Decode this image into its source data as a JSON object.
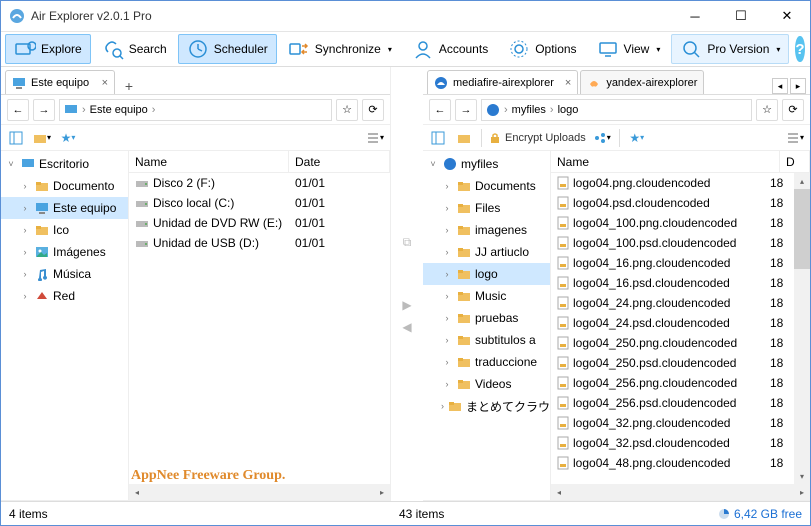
{
  "titlebar": {
    "title": "Air Explorer v2.0.1 Pro"
  },
  "toolbar": {
    "explore": "Explore",
    "search": "Search",
    "scheduler": "Scheduler",
    "synchronize": "Synchronize",
    "accounts": "Accounts",
    "options": "Options",
    "view": "View",
    "pro": "Pro Version"
  },
  "left": {
    "tabs": [
      {
        "label": "Este equipo"
      }
    ],
    "breadcrumb": [
      "Este equipo"
    ],
    "columns": {
      "name": "Name",
      "date": "Date"
    },
    "tree_root": "Escritorio",
    "tree": [
      {
        "label": "Documento",
        "icon": "folder"
      },
      {
        "label": "Este equipo",
        "icon": "pc",
        "selected": true
      },
      {
        "label": "Ico",
        "icon": "folder"
      },
      {
        "label": "Imágenes",
        "icon": "picture"
      },
      {
        "label": "Música",
        "icon": "music"
      },
      {
        "label": "Red",
        "icon": "net"
      }
    ],
    "rows": [
      {
        "name": "Disco 2 (F:)",
        "date": "01/01"
      },
      {
        "name": "Disco local (C:)",
        "date": "01/01"
      },
      {
        "name": "Unidad de DVD RW (E:)",
        "date": "01/01"
      },
      {
        "name": "Unidad de USB (D:)",
        "date": "01/01"
      }
    ],
    "status": "4 items"
  },
  "right": {
    "tabs": [
      {
        "label": "mediafire-airexplorer",
        "active": true
      },
      {
        "label": "yandex-airexplorer",
        "active": false
      }
    ],
    "breadcrumb": [
      "myfiles",
      "logo"
    ],
    "encrypt_label": "Encrypt Uploads",
    "columns": {
      "name": "Name",
      "d": "D"
    },
    "tree_root": "myfiles",
    "tree": [
      {
        "label": "Documents"
      },
      {
        "label": "Files"
      },
      {
        "label": "imagenes"
      },
      {
        "label": "JJ artiuclo"
      },
      {
        "label": "logo",
        "selected": true
      },
      {
        "label": "Music"
      },
      {
        "label": "pruebas"
      },
      {
        "label": "subtitulos a"
      },
      {
        "label": "traduccione"
      },
      {
        "label": "Videos"
      },
      {
        "label": "まとめてクラウ"
      }
    ],
    "rows": [
      {
        "name": "logo04.png.cloudencoded",
        "d": "18"
      },
      {
        "name": "logo04.psd.cloudencoded",
        "d": "18"
      },
      {
        "name": "logo04_100.png.cloudencoded",
        "d": "18"
      },
      {
        "name": "logo04_100.psd.cloudencoded",
        "d": "18"
      },
      {
        "name": "logo04_16.png.cloudencoded",
        "d": "18"
      },
      {
        "name": "logo04_16.psd.cloudencoded",
        "d": "18"
      },
      {
        "name": "logo04_24.png.cloudencoded",
        "d": "18"
      },
      {
        "name": "logo04_24.psd.cloudencoded",
        "d": "18"
      },
      {
        "name": "logo04_250.png.cloudencoded",
        "d": "18"
      },
      {
        "name": "logo04_250.psd.cloudencoded",
        "d": "18"
      },
      {
        "name": "logo04_256.png.cloudencoded",
        "d": "18"
      },
      {
        "name": "logo04_256.psd.cloudencoded",
        "d": "18"
      },
      {
        "name": "logo04_32.png.cloudencoded",
        "d": "18"
      },
      {
        "name": "logo04_32.psd.cloudencoded",
        "d": "18"
      },
      {
        "name": "logo04_48.png.cloudencoded",
        "d": "18"
      }
    ],
    "status": "43 items",
    "freespace": "6,42 GB free"
  },
  "watermark": "AppNee Freeware Group."
}
